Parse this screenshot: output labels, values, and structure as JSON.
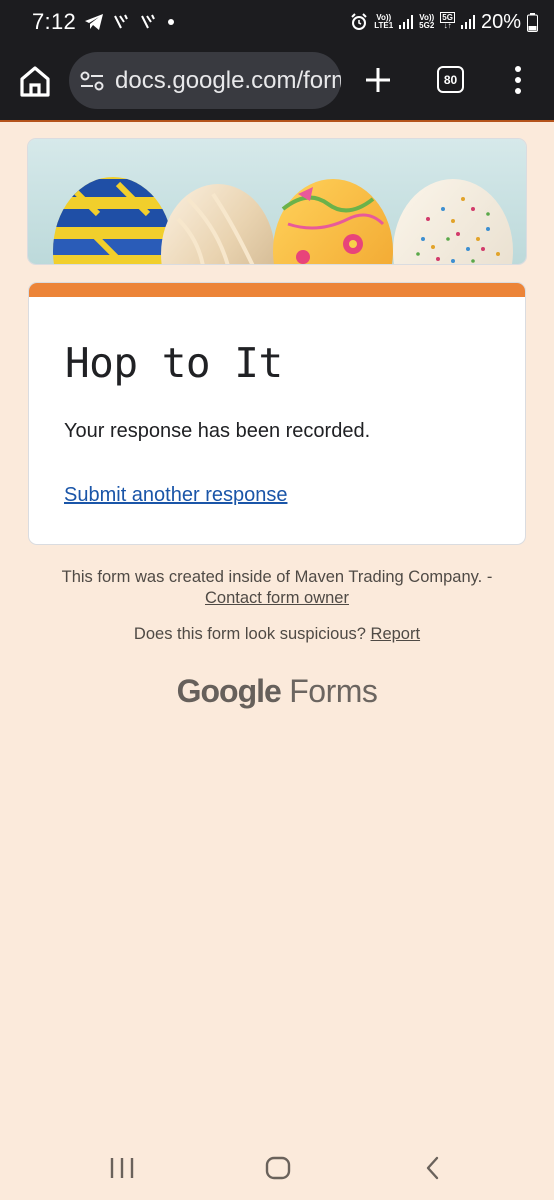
{
  "status_bar": {
    "time": "7:12",
    "net1_top": "Vo))",
    "net1_bottom": "LTE1",
    "net2_top": "Vo))",
    "net2_bottom": "5G2",
    "net3_top": "5G",
    "battery": "20%"
  },
  "browser": {
    "url": "docs.google.com/forms",
    "tab_count": "80"
  },
  "form": {
    "title": "Hop to It",
    "confirmation": "Your response has been recorded.",
    "submit_another": "Submit another response"
  },
  "footer": {
    "created_text": "This form was created inside of Maven Trading Company. -",
    "contact_owner": "Contact form owner",
    "suspicious_text": "Does this form look suspicious?",
    "report": "Report",
    "logo_google": "Google",
    "logo_forms": "Forms"
  },
  "colors": {
    "page_bg": "#fbeadb",
    "accent": "#ec8438",
    "link": "#1a55a8",
    "chrome_bg": "#1c1c1f"
  },
  "icons": [
    "telegram-icon",
    "alarm-icon",
    "signal-icon",
    "battery-icon",
    "home-icon",
    "site-settings-icon",
    "plus-icon",
    "tabs-icon",
    "more-vert-icon",
    "recents-icon",
    "nav-home-icon",
    "back-icon"
  ]
}
